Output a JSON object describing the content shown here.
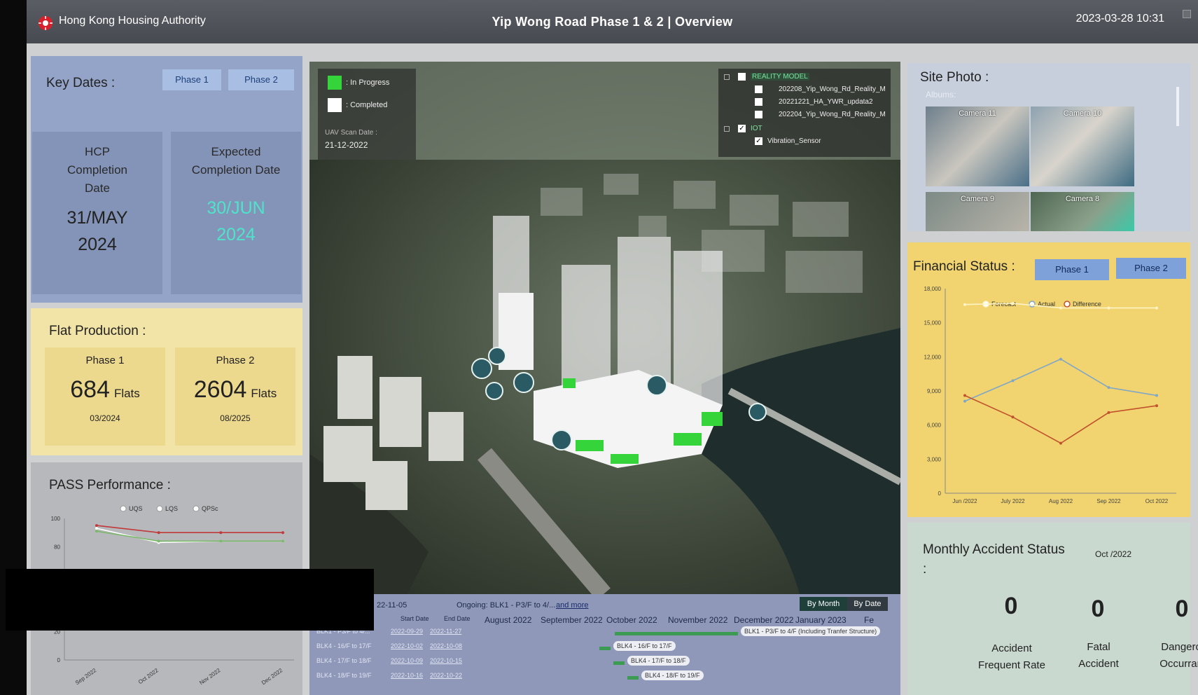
{
  "header": {
    "org": "Hong Kong Housing Authority",
    "title": "Yip Wong Road Phase 1 & 2 | Overview",
    "datetime": "2023-03-28 10:31"
  },
  "key_dates": {
    "title": "Key Dates :",
    "tabs": [
      "Phase 1",
      "Phase 2"
    ],
    "hcp_label": [
      "HCP",
      "Completion",
      "Date"
    ],
    "hcp_value": [
      "31/MAY",
      "2024"
    ],
    "expected_label": [
      "Expected",
      "Completion Date"
    ],
    "expected_value": [
      "30/JUN",
      "2024"
    ]
  },
  "flat_production": {
    "title": "Flat Production :",
    "phases": [
      {
        "name": "Phase 1",
        "count": "684",
        "unit": "Flats",
        "date": "03/2024"
      },
      {
        "name": "Phase 2",
        "count": "2604",
        "unit": "Flats",
        "date": "08/2025"
      }
    ]
  },
  "pass": {
    "title": "PASS Performance :",
    "legend": [
      "UQS",
      "LQS",
      "QPSc"
    ],
    "y_ticks": [
      "100",
      "80",
      "20",
      "0"
    ],
    "x_ticks": [
      "Sep 2022",
      "Oct 2022",
      "Nov 2022",
      "Dec 2022"
    ]
  },
  "map": {
    "legend": [
      {
        "label": ": In Progress",
        "color": "#35d43a"
      },
      {
        "label": ": Completed",
        "color": "#ffffff"
      }
    ],
    "scan_label": "UAV Scan Date :",
    "scan_date": "21-12-2022",
    "layers": {
      "group1": "REALITY MODEL",
      "items1": [
        "202208_Yip_Wong_Rd_Reality_M",
        "20221221_HA_YWR_updata2",
        "202204_Yip_Wong_Rd_Reality_M"
      ],
      "group2": "IOT",
      "items2": [
        "Vibration_Sensor"
      ]
    }
  },
  "gantt": {
    "date_prefix": "22-11-05",
    "ongoing": "Ongoing: BLK1 - P3/F to 4/...",
    "and_more": "and more",
    "by_month": "By Month",
    "by_date": "By Date",
    "col_start": "Start Date",
    "col_end": "End Date",
    "months": [
      "August 2022",
      "September 2022",
      "October 2022",
      "November 2022",
      "December 2022",
      "January 2023",
      "Fe"
    ],
    "rows": [
      {
        "name": "BLK1 - P3/F to 4/...",
        "start": "2022-09-29",
        "end": "2022-11-27",
        "bar": "BLK1 - P3/F to 4/F (Including Tranfer Structure)"
      },
      {
        "name": "BLK4 - 16/F to 17/F",
        "start": "2022-10-02",
        "end": "2022-10-08",
        "bar": "BLK4 - 16/F to 17/F"
      },
      {
        "name": "BLK4 - 17/F to 18/F",
        "start": "2022-10-09",
        "end": "2022-10-15",
        "bar": "BLK4 - 17/F to 18/F"
      },
      {
        "name": "BLK4 - 18/F to 19/F",
        "start": "2022-10-16",
        "end": "2022-10-22",
        "bar": "BLK4 - 18/F to 19/F"
      }
    ]
  },
  "site_photo": {
    "title": "Site Photo :",
    "albums": "Albums:",
    "cameras": [
      "Camera 11",
      "Camera 10",
      "Camera 9",
      "Camera 8"
    ]
  },
  "financial": {
    "title": "Financial Status :",
    "tabs": [
      "Phase 1",
      "Phase 2"
    ]
  },
  "accident": {
    "title": "Monthly Accident Status",
    "colon": ":",
    "month": "Oct /2022",
    "items": [
      {
        "value": "0",
        "label": [
          "Accident",
          "Frequent Rate"
        ]
      },
      {
        "value": "0",
        "label": [
          "Fatal",
          "Accident"
        ]
      },
      {
        "value": "0",
        "label": [
          "Dangerous",
          "Occurrance"
        ]
      }
    ]
  },
  "chart_data": [
    {
      "type": "line",
      "title": "",
      "x": [
        "Jun /2022",
        "July 2022",
        "Aug 2022",
        "Sep 2022",
        "Oct 2022"
      ],
      "ylim": [
        0,
        18000
      ],
      "y_ticks": [
        0,
        3000,
        6000,
        9000,
        12000,
        15000,
        18000
      ],
      "y_tick_labels": [
        "0",
        "3,000",
        "6,000",
        "9,000",
        "12,000",
        "15,000",
        "18,000"
      ],
      "legend_position": "top",
      "series": [
        {
          "name": "Forecast",
          "color": "#fff4c8",
          "values": [
            16600,
            16700,
            16300,
            16300,
            16300
          ]
        },
        {
          "name": "Actual",
          "color": "#7fa6c8",
          "values": [
            8100,
            9900,
            11800,
            9300,
            8600
          ]
        },
        {
          "name": "Difference",
          "color": "#c0522e",
          "values": [
            8600,
            6700,
            4400,
            7100,
            7700
          ]
        }
      ]
    },
    {
      "type": "line",
      "title": "",
      "x": [
        "Sep 2022",
        "Oct 2022",
        "Nov 2022",
        "Dec 2022"
      ],
      "ylim": [
        0,
        100
      ],
      "series": [
        {
          "name": "UQS",
          "color": "#c0393b",
          "values": [
            95,
            90,
            90,
            90
          ]
        },
        {
          "name": "LQS",
          "color": "#ffffff",
          "values": [
            93,
            83,
            84,
            84
          ]
        },
        {
          "name": "QPSc",
          "color": "#7ab86a",
          "values": [
            91,
            84,
            84,
            84
          ]
        }
      ]
    }
  ]
}
